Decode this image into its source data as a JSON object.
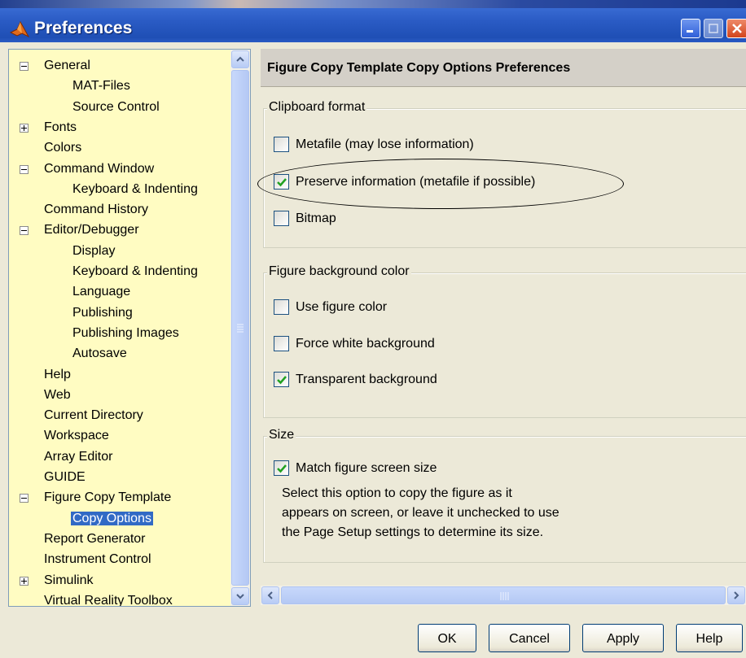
{
  "window": {
    "title": "Preferences"
  },
  "tree": {
    "items": [
      {
        "label": "General",
        "expander": "minus",
        "indent": 0
      },
      {
        "label": "MAT-Files",
        "indent": 1
      },
      {
        "label": "Source Control",
        "indent": 1
      },
      {
        "label": "Fonts",
        "expander": "plus",
        "indent": 0
      },
      {
        "label": "Colors",
        "indent": 0
      },
      {
        "label": "Command Window",
        "expander": "minus",
        "indent": 0
      },
      {
        "label": "Keyboard & Indenting",
        "indent": 1
      },
      {
        "label": "Command History",
        "indent": 0
      },
      {
        "label": "Editor/Debugger",
        "expander": "minus",
        "indent": 0
      },
      {
        "label": "Display",
        "indent": 1
      },
      {
        "label": "Keyboard & Indenting",
        "indent": 1
      },
      {
        "label": "Language",
        "indent": 1
      },
      {
        "label": "Publishing",
        "indent": 1
      },
      {
        "label": "Publishing Images",
        "indent": 1
      },
      {
        "label": "Autosave",
        "indent": 1
      },
      {
        "label": "Help",
        "indent": 0
      },
      {
        "label": "Web",
        "indent": 0
      },
      {
        "label": "Current Directory",
        "indent": 0
      },
      {
        "label": "Workspace",
        "indent": 0
      },
      {
        "label": "Array Editor",
        "indent": 0
      },
      {
        "label": "GUIDE",
        "indent": 0
      },
      {
        "label": "Figure Copy Template",
        "expander": "minus",
        "indent": 0
      },
      {
        "label": "Copy Options",
        "indent": 1,
        "selected": true
      },
      {
        "label": "Report Generator",
        "indent": 0
      },
      {
        "label": "Instrument Control",
        "indent": 0
      },
      {
        "label": "Simulink",
        "expander": "plus",
        "indent": 0
      },
      {
        "label": "Virtual Reality Toolbox",
        "indent": 0
      }
    ]
  },
  "panel": {
    "title": "Figure Copy Template Copy Options Preferences",
    "clipboard": {
      "title": "Clipboard format",
      "options": [
        {
          "label": "Metafile (may lose information)",
          "checked": false
        },
        {
          "label": "Preserve information (metafile if possible)",
          "checked": true
        },
        {
          "label": "Bitmap",
          "checked": false
        }
      ]
    },
    "background": {
      "title": "Figure background color",
      "options": [
        {
          "label": "Use figure color",
          "checked": false
        },
        {
          "label": "Force white background",
          "checked": false
        },
        {
          "label": "Transparent background",
          "checked": true
        }
      ]
    },
    "size": {
      "title": "Size",
      "option": {
        "label": "Match figure screen size",
        "checked": true
      },
      "description": [
        "Select this option to copy the figure as it",
        "appears on screen, or leave it unchecked to use",
        "the Page Setup settings to determine its size."
      ]
    }
  },
  "buttons": {
    "ok": "OK",
    "cancel": "Cancel",
    "apply": "Apply",
    "help": "Help"
  },
  "colors": {
    "tree_bg": "#fffcc2",
    "selection": "#316ac5",
    "titlebar": "#2a5bc4",
    "check": "#21a121"
  }
}
